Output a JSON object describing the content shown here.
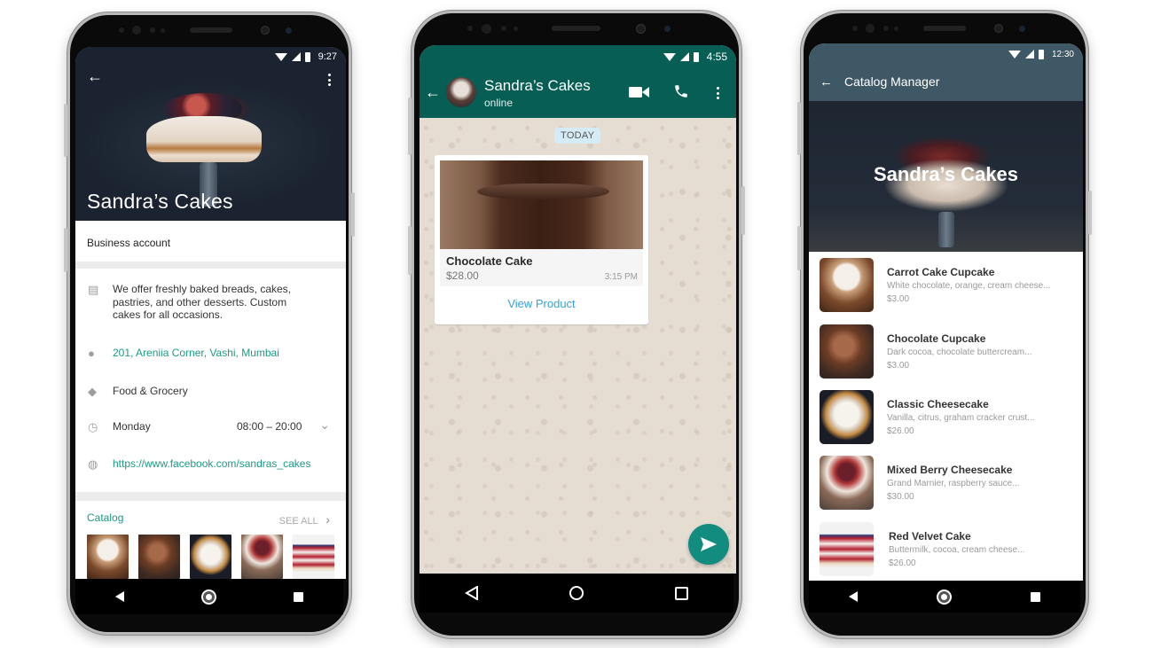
{
  "phone1": {
    "status_time": "9:27",
    "business_name": "Sandra’s Cakes",
    "account_type": "Business account",
    "description": "We offer freshly baked breads, cakes, pastries, and other desserts. Custom cakes for all occasions.",
    "address": "201, Areniia Corner, Vashi, Mumbai",
    "category": "Food & Grocery",
    "hours_day": "Monday",
    "hours_time": "08:00 – 20:00",
    "website": "https://www.facebook.com/sandras_cakes",
    "catalog_label": "Catalog",
    "see_all_label": "SEE ALL",
    "catalog_thumbs": [
      "Carrot Cake Cupcake",
      "Chocolate Cupcake",
      "Classic Cheesecake",
      "Mixed Berry Cheesecake",
      "Red Velvet Cake"
    ],
    "icons": {
      "back": "←",
      "store": "▤",
      "location": "●",
      "tag": "◆",
      "clock": "◷",
      "globe": "◍",
      "chevron_down": "⌄",
      "chevron_right": "›"
    }
  },
  "phone2": {
    "status_time": "4:55",
    "chat_name": "Sandra’s Cakes",
    "chat_status": "online",
    "date_chip": "TODAY",
    "product": {
      "name": "Chocolate Cake",
      "price": "$28.00",
      "time": "3:15 PM",
      "action": "View Product"
    },
    "icons": {
      "back": "←"
    },
    "colors": {
      "header": "#075e54",
      "fab": "#128c7e",
      "link": "#34a3d8"
    }
  },
  "phone3": {
    "status_time": "12:30",
    "header_title": "Catalog Manager",
    "hero_title": "Sandra’s Cakes",
    "icons": {
      "back": "←"
    },
    "items": [
      {
        "name": "Carrot Cake Cupcake",
        "desc": "White chocolate, orange, cream cheese...",
        "price": "$3.00"
      },
      {
        "name": "Chocolate Cupcake",
        "desc": "Dark cocoa, chocolate buttercream...",
        "price": "$3.00"
      },
      {
        "name": "Classic Cheesecake",
        "desc": "Vanilla, citrus, graham cracker crust...",
        "price": "$26.00"
      },
      {
        "name": "Mixed Berry Cheesecake",
        "desc": "Grand Marnier, raspberry sauce...",
        "price": "$30.00"
      },
      {
        "name": "Red Velvet Cake",
        "desc": "Buttermilk, cocoa, cream cheese...",
        "price": "$26.00"
      }
    ]
  }
}
